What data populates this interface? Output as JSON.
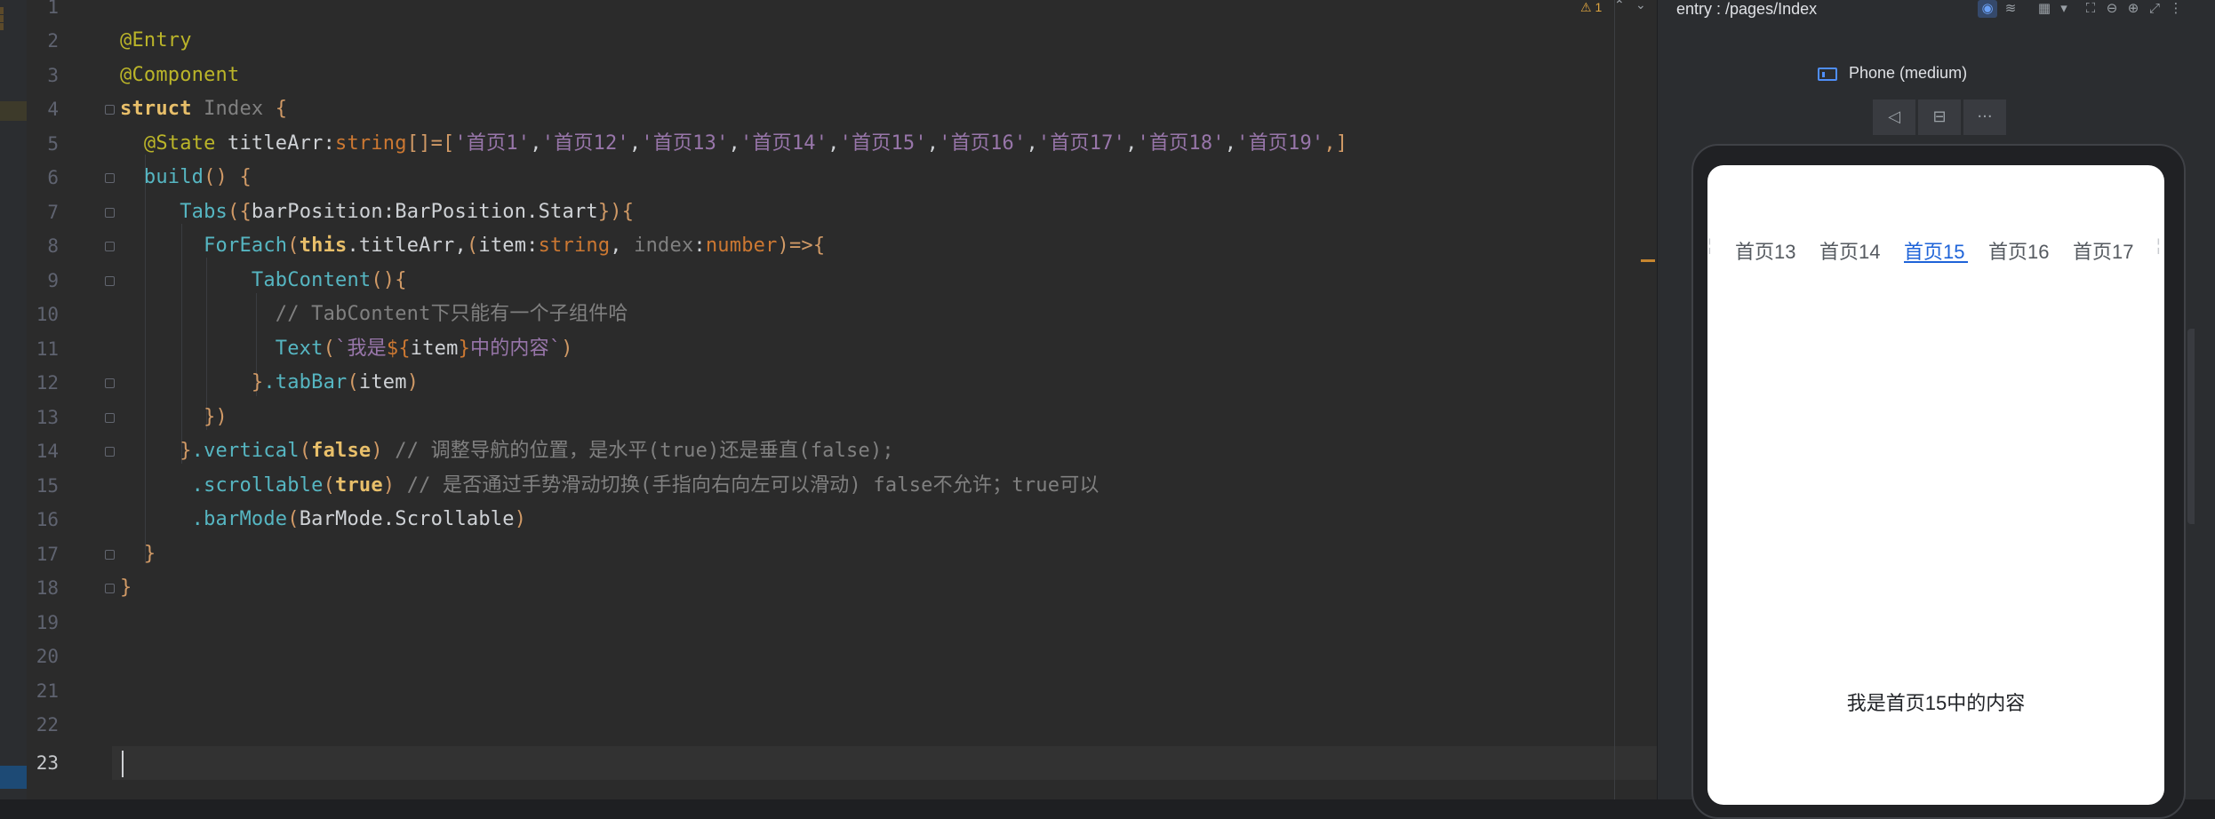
{
  "editor": {
    "line_numbers": [
      "1",
      "2",
      "3",
      "4",
      "5",
      "6",
      "7",
      "8",
      "9",
      "10",
      "11",
      "12",
      "13",
      "14",
      "15",
      "16",
      "17",
      "18",
      "19",
      "20",
      "21",
      "22",
      "23"
    ],
    "current_line": "23",
    "inspection_count": "1",
    "code": {
      "l2": {
        "a": "@Entry"
      },
      "l3": {
        "a": "@Component"
      },
      "l4": {
        "a": "struct",
        "b": " Index ",
        "c": "{"
      },
      "l5": {
        "a": "  @State ",
        "b": "titleArr",
        "c": ":",
        "d": "string",
        "e": "[]=[",
        "f": "'首页1'",
        "g": ",",
        "h": "'首页12'",
        "i": ",",
        "j": "'首页13'",
        "k": ",",
        "l": "'首页14'",
        "m": ",",
        "n": "'首页15'",
        "o": ",",
        "p": "'首页16'",
        "q": ",",
        "r": "'首页17'",
        "s": ",",
        "t": "'首页18'",
        "u": ",",
        "v": "'首页19'",
        "w": ",]"
      },
      "l6": {
        "a": "  build",
        "b": "() ",
        "c": "{"
      },
      "l7": {
        "a": "     Tabs",
        "b": "(",
        "c": "{",
        "d": "barPosition:BarPosition.Start",
        "e": "}",
        "f": ")",
        "g": "{"
      },
      "l8": {
        "a": "       ForEach",
        "b": "(",
        "c": "this",
        "d": ".titleArr,",
        "e": "(",
        "f": "item:",
        "g": "string",
        "h": ", ",
        "i": "index",
        "j": ":",
        "k": "number",
        "l": ")=>{"
      },
      "l9": {
        "a": "           TabContent",
        "b": "()",
        "c": "{"
      },
      "l10": {
        "a": "             // TabContent下只能有一个子组件哈"
      },
      "l11": {
        "a": "             Text",
        "b": "(",
        "c": "`我是",
        "d": "${",
        "e": "item",
        "f": "}",
        "g": "中的内容`",
        "h": ")"
      },
      "l12": {
        "a": "           }",
        "b": ".tabBar",
        "c": "(",
        "d": "item",
        "e": ")"
      },
      "l13": {
        "a": "       })"
      },
      "l14": {
        "a": "     }",
        "b": ".vertical",
        "c": "(",
        "d": "false",
        "e": ")",
        "f": " // 调整导航的位置，是水平(true)还是垂直(false);"
      },
      "l15": {
        "a": "      .scrollable",
        "b": "(",
        "c": "true",
        "d": ")",
        "e": " // 是否通过手势滑动切换(手指向右向左可以滑动) false不允许；true可以"
      },
      "l16": {
        "a": "      .barMode",
        "b": "(",
        "c": "BarMode.Scrollable",
        "d": ")"
      },
      "l17": {
        "a": "  }"
      },
      "l18": {
        "a": "}"
      }
    }
  },
  "preview": {
    "title": "entry : /pages/Index",
    "device": "Phone (medium)",
    "controls": {
      "back": "◁",
      "rotate": "⊟",
      "more": "···"
    },
    "tabs": [
      "首页13",
      "首页14",
      "首页15",
      "首页16",
      "首页17"
    ],
    "active_tab": "首页15",
    "content_text": "我是首页15中的内容"
  },
  "icons": {
    "inspection": "warning-icon",
    "eye": "eye-icon",
    "layers": "layers-icon",
    "grid": "grid-icon"
  },
  "colors": {
    "editor_bg": "#2b2b2b",
    "active_tab": "#1e63d8"
  }
}
